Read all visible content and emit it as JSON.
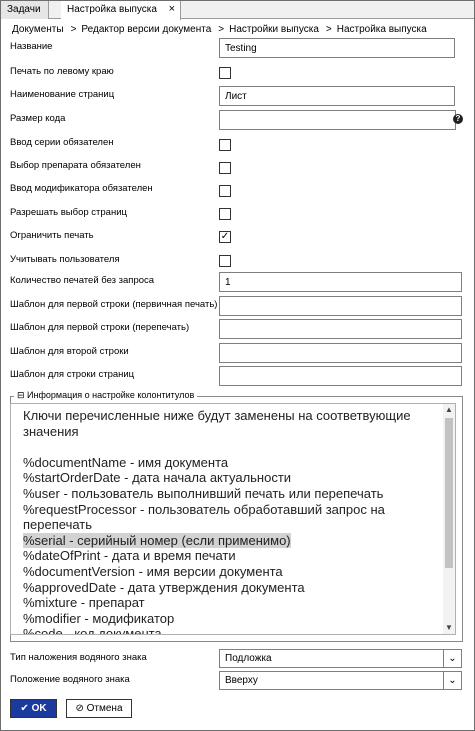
{
  "tabs": [
    {
      "label": "Задачи"
    },
    {
      "label": "Настройка выпуска",
      "close": "×"
    }
  ],
  "breadcrumb": [
    "Документы",
    "Редактор версии документа",
    "Настройки выпуска",
    "Настройка выпуска"
  ],
  "breadcrumb_sep": ">",
  "form": {
    "name_label": "Название",
    "name_value": "Testing",
    "print_left_label": "Печать по левому краю",
    "pages_name_label": "Наименование страниц",
    "pages_name_value": "Лист",
    "code_size_label": "Размер кода",
    "code_size_value": "",
    "help_glyph": "?",
    "series_required_label": "Ввод серии обязателен",
    "drug_select_label": "Выбор препарата обязателен",
    "modifier_required_label": "Ввод модификатора обязателен",
    "allow_pages_label": "Разрешать выбор страниц",
    "limit_print_label": "Ограничить печать",
    "limit_print_checked": "✓",
    "track_user_label": "Учитывать пользователя",
    "prints_count_label": "Количество печатей без запроса",
    "prints_count_value": "1",
    "tpl_first_label": "Шаблон для первой строки (первичная печать)",
    "tpl_first_value": "",
    "tpl_first_reprint_label": "Шаблон для первой строки (перепечать)",
    "tpl_first_reprint_value": "",
    "tpl_second_label": "Шаблон для второй строки",
    "tpl_second_value": "",
    "tpl_pages_label": "Шаблон для строки страниц",
    "tpl_pages_value": ""
  },
  "info": {
    "legend": "⊟ Информация о настройке колонтитулов",
    "text_before": "Ключи перечисленные ниже будут заменены на соответвующие значения\n\n%documentName - имя документа\n%startOrderDate - дата начала актуальности\n%user - пользователь выполнивший печать или перепечать\n%requestProcessor - пользователь обработавший запрос на перепечать\n",
    "text_highlight": "%serial - серийный номер (если применимо)",
    "text_after": "\n%dateOfPrint - дата и время печати\n%documentVersion - имя версии документа\n%approvedDate - дата утверждения документа\n%mixture - препарат\n%modifier - модификатор\n%code - код документа",
    "scroll_up": "▲",
    "scroll_down": "▼"
  },
  "watermark": {
    "type_label": "Тип наложения водяного знака",
    "type_value": "Подложка",
    "position_label": "Положение водяного знака",
    "position_value": "Вверху",
    "chevron": "⌄"
  },
  "buttons": {
    "ok_icon": "✔",
    "ok_label": "OK",
    "cancel_icon": "⊘",
    "cancel_label": "Отмена"
  }
}
